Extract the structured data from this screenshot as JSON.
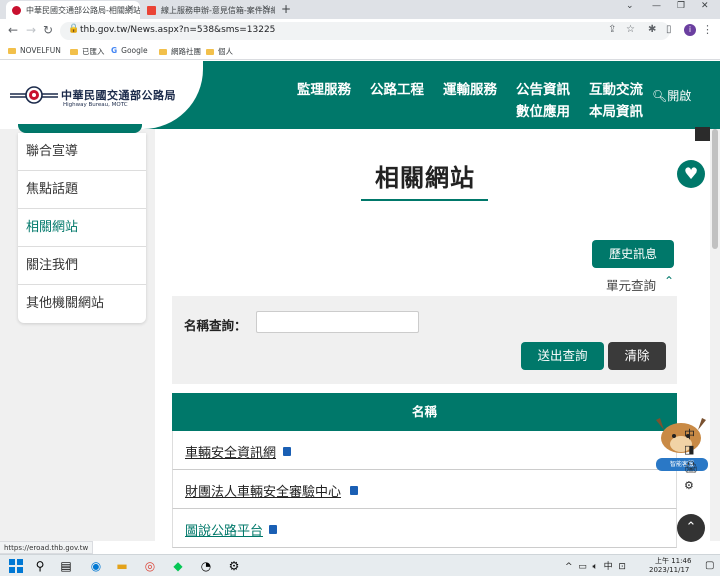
{
  "browser": {
    "tabs": [
      {
        "title": "中華民國交通部公路局-相關網站",
        "active": true,
        "favicon_color": "#c8102e"
      },
      {
        "title": "線上服務申辦-意見信箱-案件詳細",
        "active": false,
        "favicon_color": "#ea4335"
      }
    ],
    "url": "thb.gov.tw/News.aspx?n=538&sms=13225",
    "profile_initial": "i",
    "bookmarks": [
      "NOVELFUN",
      "已匯入",
      "Google",
      "網路社團",
      "個人"
    ]
  },
  "site": {
    "logo_zh": "中華民國交通部公路局",
    "logo_en": "Highway Bureau, MOTC",
    "nav_row1": [
      "監理服務",
      "公路工程",
      "運輸服務",
      "公告資訊",
      "互動交流"
    ],
    "nav_row2": [
      "數位應用",
      "本局資訊"
    ],
    "search_label": "開啟",
    "brand_color": "#00786a"
  },
  "sidebar": {
    "items": [
      {
        "label": "聯合宣導",
        "active": false
      },
      {
        "label": "焦點話題",
        "active": false
      },
      {
        "label": "相關網站",
        "active": true
      },
      {
        "label": "關注我們",
        "active": false
      },
      {
        "label": "其他機關網站",
        "active": false
      }
    ]
  },
  "main": {
    "title": "相關網站",
    "history_button": "歷史訊息",
    "unit_query": "單元查詢",
    "search": {
      "name_label": "名稱查詢：",
      "name_value": "",
      "submit_button": "送出查詢",
      "clear_button": "清除"
    },
    "table": {
      "header": "名稱",
      "rows": [
        {
          "name": "車輛安全資訊網"
        },
        {
          "name": "財團法人車輛安全審驗中心"
        },
        {
          "name": "圖說公路平台"
        }
      ]
    }
  },
  "widgets": {
    "mascot_label": "智能客服",
    "tools": [
      "中",
      "◨",
      "🖨",
      "⚙"
    ]
  },
  "status_url": "https://eroad.thb.gov.tw",
  "taskbar": {
    "ime": "中",
    "time": "上午 11:46",
    "date": "2023/11/17"
  }
}
